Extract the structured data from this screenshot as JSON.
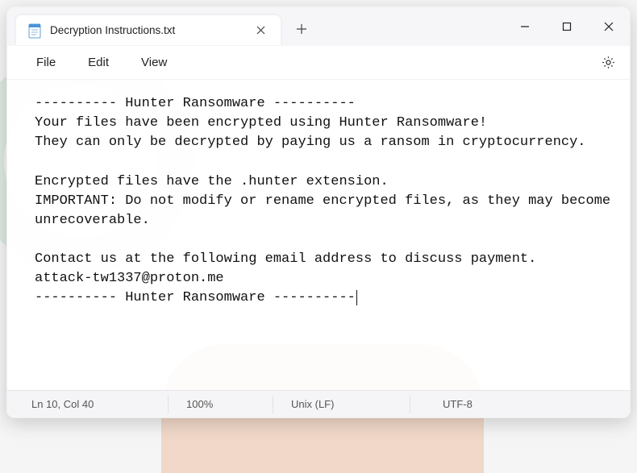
{
  "titlebar": {
    "tab_title": "Decryption Instructions.txt"
  },
  "menubar": {
    "file": "File",
    "edit": "Edit",
    "view": "View"
  },
  "content": {
    "text": "---------- Hunter Ransomware ----------\nYour files have been encrypted using Hunter Ransomware!\nThey can only be decrypted by paying us a ransom in cryptocurrency.\n\nEncrypted files have the .hunter extension.\nIMPORTANT: Do not modify or rename encrypted files, as they may become unrecoverable.\n\nContact us at the following email address to discuss payment.\nattack-tw1337@proton.me\n---------- Hunter Ransomware ----------"
  },
  "statusbar": {
    "position": "Ln 10, Col 40",
    "zoom": "100%",
    "line_ending": "Unix (LF)",
    "encoding": "UTF-8"
  }
}
